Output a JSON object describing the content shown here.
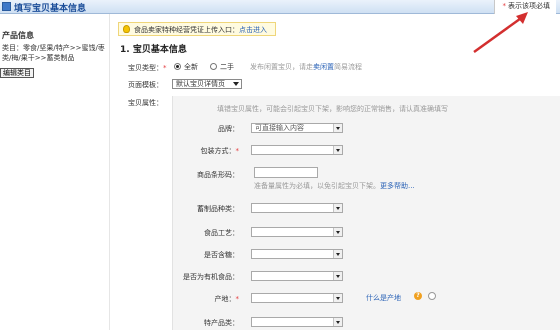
{
  "window": {
    "title": "填写宝贝基本信息"
  },
  "required_note": "表示该项必填",
  "left_panel": {
    "title": "产品信息",
    "category": "类目：零食/坚果/特产>>蜜饯/枣类/梅/果干>>蓄类制品",
    "edit_button": "编辑类目"
  },
  "notice": {
    "text": "食品卖家特种经营凭证上传入口：",
    "link": "点击进入"
  },
  "section_title": "1. 宝贝基本信息",
  "item_type": {
    "label": "宝贝类型：",
    "options": [
      "全新",
      "二手"
    ],
    "selected": "全新",
    "hint_prefix": "发布闲置宝贝，请走",
    "hint_link": "卖闲置",
    "hint_suffix": "简易流程"
  },
  "page_template": {
    "label": "页面模板：",
    "value": "默认宝贝详情页"
  },
  "attributes": {
    "label": "宝贝属性：",
    "tip": "填错宝贝属性，可能会引起宝贝下架，影响您的正常销售，请认真准确填写",
    "brand": {
      "label": "品牌：",
      "placeholder": "可直接输入内容"
    },
    "packaging": {
      "label": "包装方式："
    },
    "barcode": {
      "label": "商品条形码：",
      "hint": "准备量属性为必填，以免引起宝贝下架。",
      "help_link": "更多帮助..."
    },
    "preserved_type": {
      "label": "蓄制品种类："
    },
    "process": {
      "label": "食品工艺："
    },
    "sugar_free": {
      "label": "是否含糖："
    },
    "organic": {
      "label": "是否为有机食品："
    },
    "origin": {
      "label": "产地：",
      "what_link": "什么是产地"
    },
    "specialty": {
      "label": "特产品类："
    }
  },
  "colors": {
    "accent_blue": "#2a62b6",
    "required_red": "#e4393c",
    "arrow_red": "#d32f2f"
  }
}
